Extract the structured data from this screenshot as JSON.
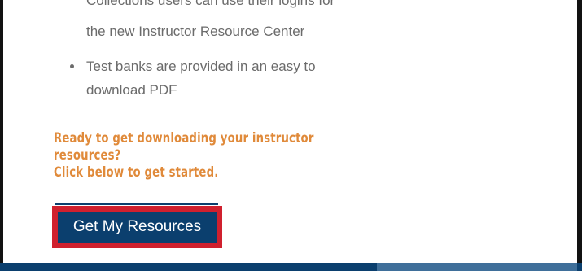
{
  "content": {
    "bullet_lines": [
      "Collections users can use their logins for",
      "the new Instructor Resource Center",
      "Test banks are provided in an easy to",
      "download PDF"
    ],
    "cta_lines": [
      "Ready to get downloading your instructor",
      "resources?",
      "Click below to get started."
    ],
    "button_label": "Get My Resources"
  },
  "colors": {
    "body_text": "#6b6b6b",
    "cta_orange": "#e08a3a",
    "button_blue": "#0b3f6e",
    "highlight_red": "#d0202e"
  }
}
